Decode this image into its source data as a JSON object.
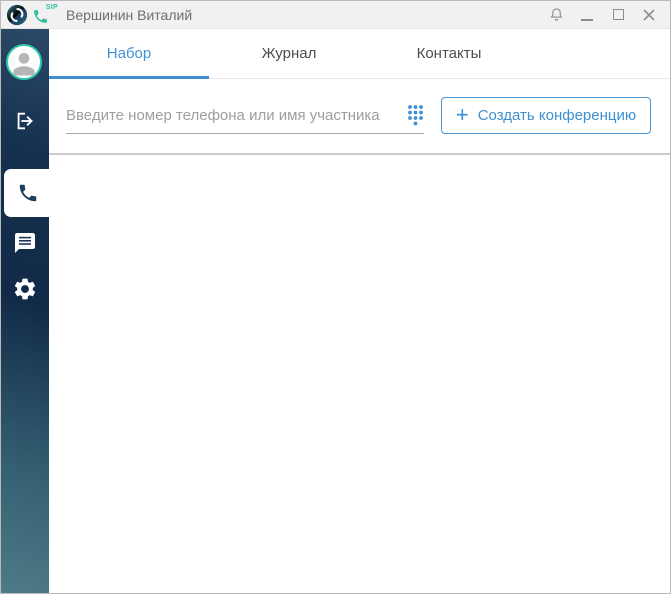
{
  "window": {
    "title": "Вершинин Виталий",
    "sip_badge": "SIP",
    "controls": {
      "bell": "bell-icon",
      "minimize": "minimize-icon",
      "maximize": "maximize-icon",
      "close": "close-icon"
    }
  },
  "sidebar": {
    "items": [
      {
        "name": "avatar",
        "icon": "user-avatar"
      },
      {
        "name": "logout",
        "icon": "logout-icon"
      },
      {
        "name": "dialer",
        "icon": "phone-icon",
        "active": true
      },
      {
        "name": "chats",
        "icon": "chat-icon"
      },
      {
        "name": "settings",
        "icon": "gear-icon"
      }
    ]
  },
  "tabs": [
    {
      "label": "Набор",
      "active": true
    },
    {
      "label": "Журнал",
      "active": false
    },
    {
      "label": "Контакты",
      "active": false
    }
  ],
  "toolbar": {
    "search_placeholder": "Введите номер телефона или имя участника",
    "search_value": "",
    "dialpad_icon": "dialpad-icon",
    "plus": "+",
    "create_conference_label": "Создать конференцию"
  },
  "colors": {
    "accent_blue": "#3e8fd4",
    "teal_green": "#2fc9a7",
    "sidebar_top": "#16304f",
    "sidebar_bottom": "#4f7a87",
    "titlebar_bg": "#f1f1f2",
    "divider_gray": "#cbcbcb",
    "inactive_tab_text": "#4d4d4d",
    "placeholder_gray": "#9e9e9e"
  }
}
